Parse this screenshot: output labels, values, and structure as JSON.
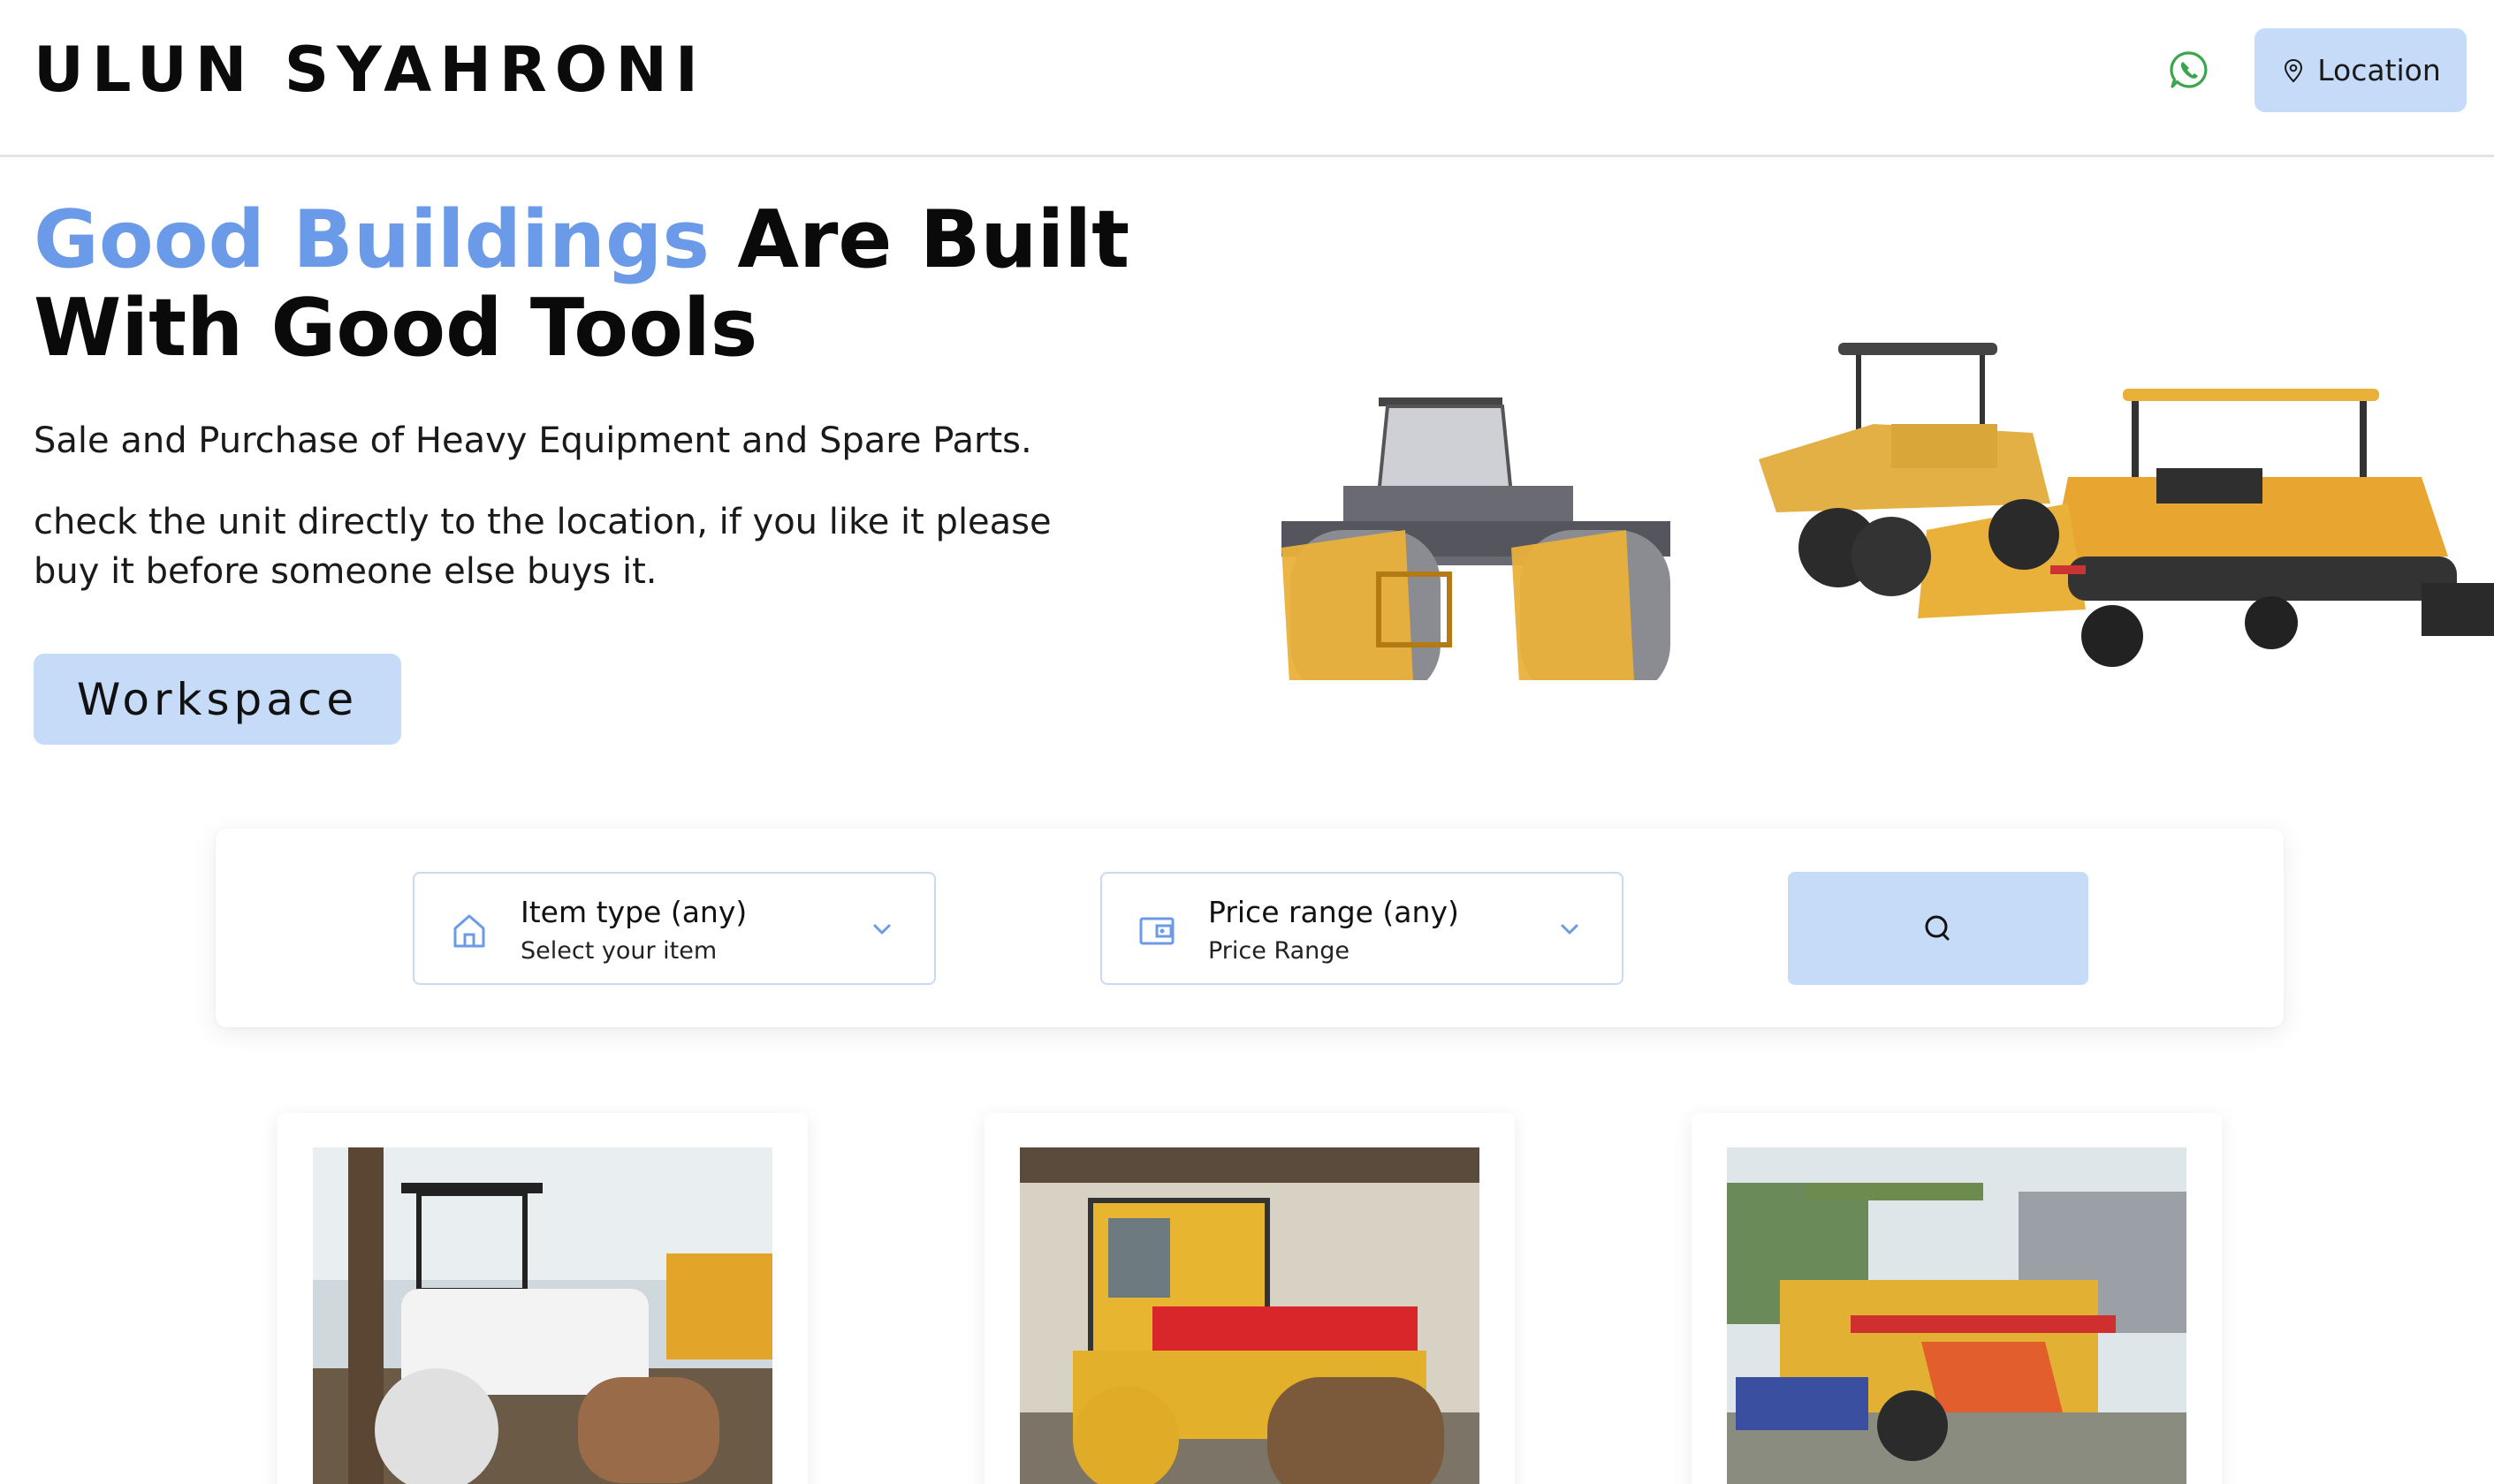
{
  "header": {
    "brand": "ULUN SYAHRONI",
    "location_label": "Location"
  },
  "hero": {
    "title_accent": "Good Buildings",
    "title_rest": " Are Built With Good Tools",
    "subtitle": "Sale and Purchase of Heavy Equipment and Spare Parts.",
    "description": "check the unit directly to the location, if you like it please buy it before someone else buys it.",
    "cta_label": "Workspace"
  },
  "search": {
    "item_type": {
      "title": "Item type (any)",
      "placeholder": "Select your item"
    },
    "price_range": {
      "title": "Price range (any)",
      "placeholder": "Price Range"
    }
  },
  "products": [
    {
      "name": "tandem-roller-white"
    },
    {
      "name": "tandem-roller-dynapac"
    },
    {
      "name": "asphalt-paver"
    }
  ],
  "colors": {
    "accent": "#6b9be8",
    "button_bg": "#c6dbf8",
    "whatsapp": "#3aa64c",
    "equipment_yellow": "#e9b13a"
  },
  "icons": {
    "whatsapp": "whatsapp-icon",
    "location": "map-pin-icon",
    "item_type": "home-icon",
    "price_range": "wallet-icon",
    "search": "search-icon",
    "dropdown": "chevron-down-icon"
  }
}
